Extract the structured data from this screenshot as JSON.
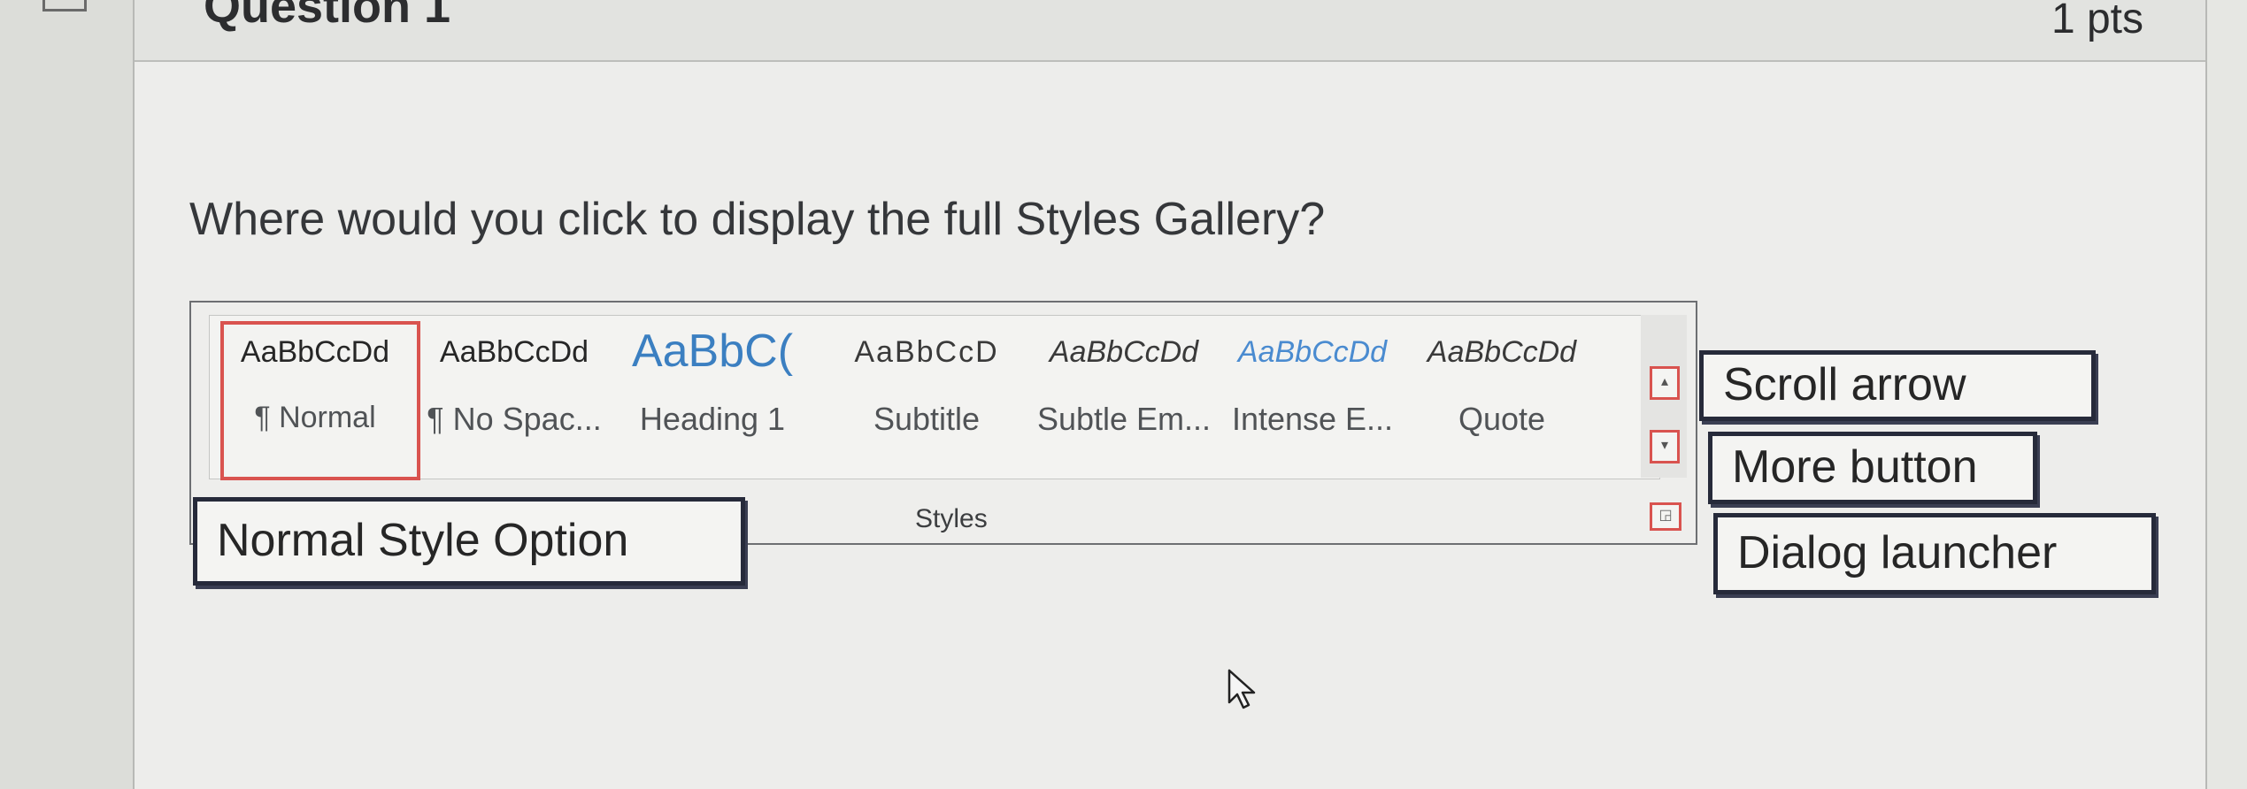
{
  "header": {
    "question_title": "Question 1",
    "points": "1 pts"
  },
  "question": {
    "text": "Where would you click to display the full Styles Gallery?"
  },
  "ribbon": {
    "group_label": "Styles",
    "styles": [
      {
        "sample": "AaBbCcDd",
        "name": "¶ Normal",
        "selected": true
      },
      {
        "sample": "AaBbCcDd",
        "name": "¶ No Spac..."
      },
      {
        "sample": "AaBbC(",
        "name": "Heading 1"
      },
      {
        "sample": "AaBbCcD",
        "name": "Subtitle"
      },
      {
        "sample": "AaBbCcDd",
        "name": "Subtle Em..."
      },
      {
        "sample": "AaBbCcDd",
        "name": "Intense E..."
      },
      {
        "sample": "AaBbCcDd",
        "name": "Quote"
      }
    ],
    "scroll_icon": "triangle-up-icon",
    "more_icon": "more-dropdown-icon",
    "launcher_icon": "dialog-launcher-icon"
  },
  "callouts": {
    "normal": "Normal Style Option",
    "scroll": "Scroll arrow",
    "more": "More button",
    "dialog": "Dialog launcher"
  },
  "colors": {
    "highlight_red": "#d9534f",
    "heading_blue": "#3b7fc1",
    "intense_blue": "#4a8bd0",
    "callout_border": "#262a3a"
  }
}
